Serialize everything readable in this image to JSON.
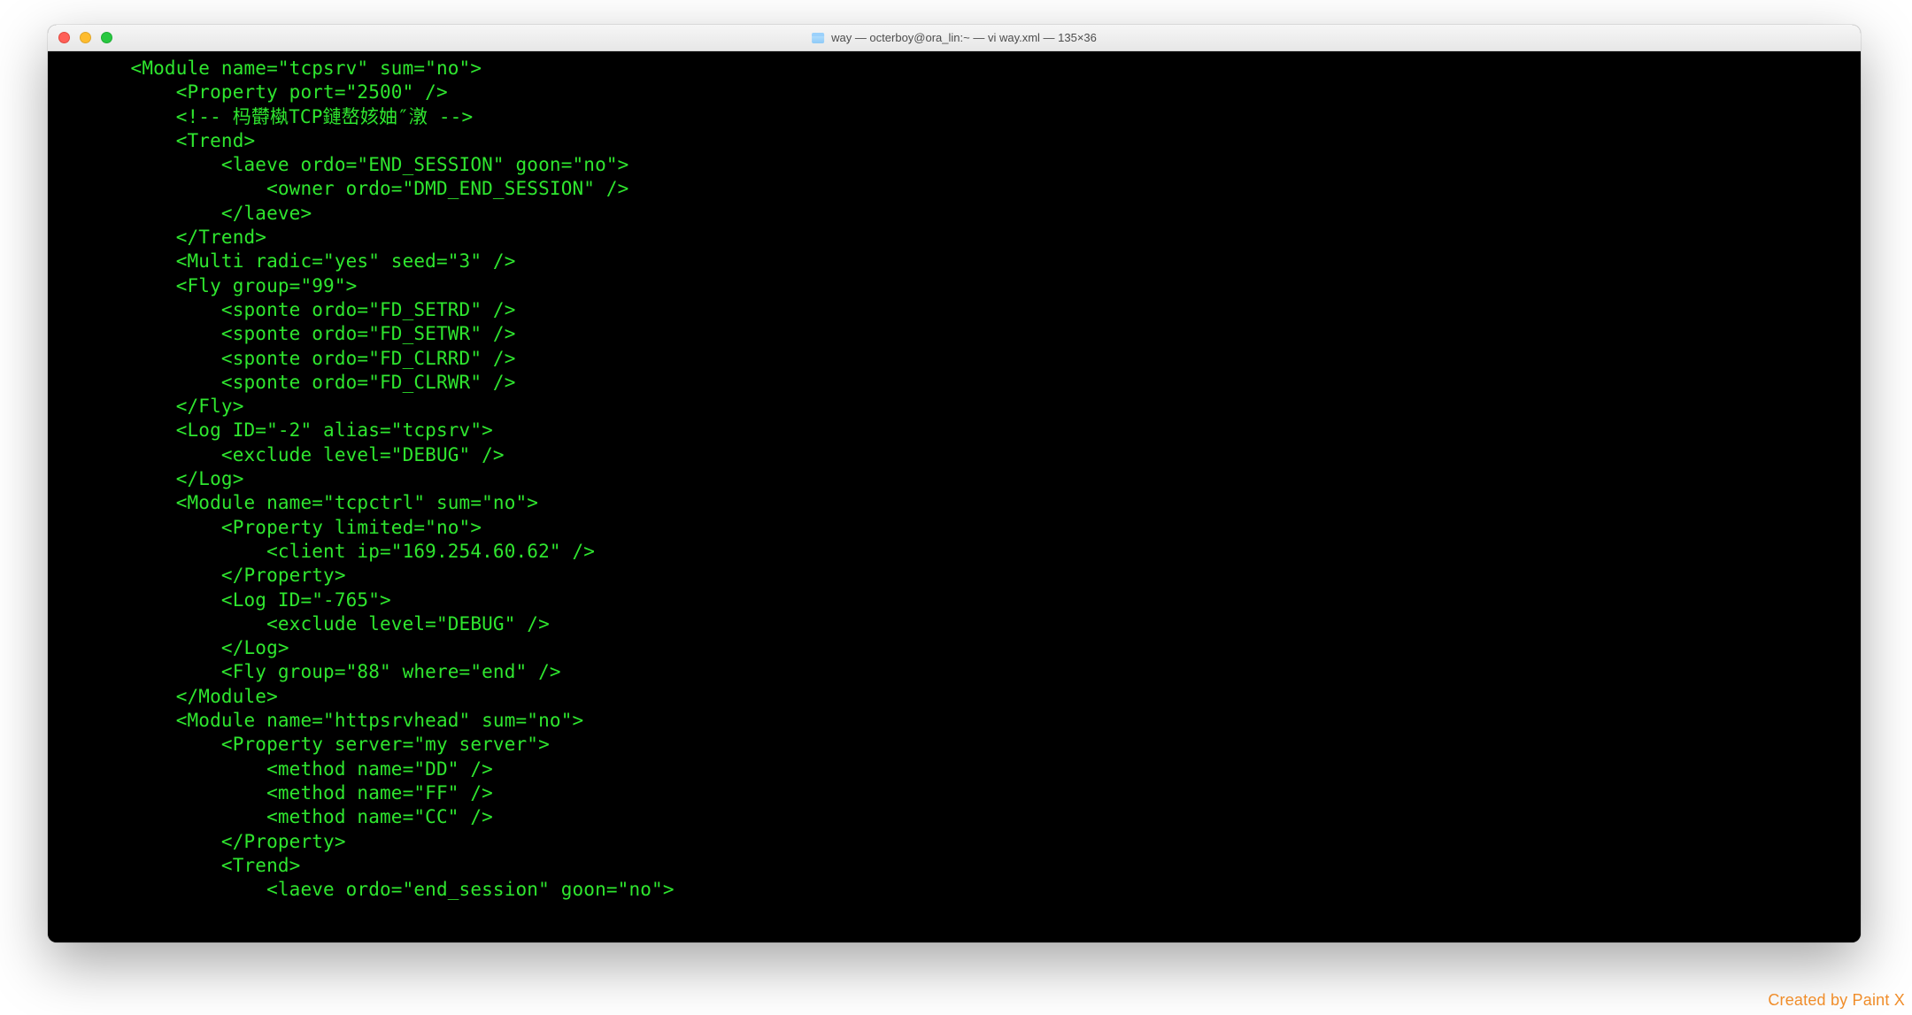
{
  "window": {
    "title": "way — octerboy@ora_lin:~ — vi way.xml — 135×36"
  },
  "terminal": {
    "lines": [
      "       <Module name=\"tcpsrv\" sum=\"no\">",
      "           <Property port=\"2500\" />",
      "           <!-- 杩欎槸TCP鏈嶅姟妯″潡 -->",
      "           <Trend>",
      "               <laeve ordo=\"END_SESSION\" goon=\"no\">",
      "                   <owner ordo=\"DMD_END_SESSION\" />",
      "               </laeve>",
      "           </Trend>",
      "           <Multi radic=\"yes\" seed=\"3\" />",
      "           <Fly group=\"99\">",
      "               <sponte ordo=\"FD_SETRD\" />",
      "               <sponte ordo=\"FD_SETWR\" />",
      "               <sponte ordo=\"FD_CLRRD\" />",
      "               <sponte ordo=\"FD_CLRWR\" />",
      "           </Fly>",
      "           <Log ID=\"-2\" alias=\"tcpsrv\">",
      "               <exclude level=\"DEBUG\" />",
      "           </Log>",
      "           <Module name=\"tcpctrl\" sum=\"no\">",
      "               <Property limited=\"no\">",
      "                   <client ip=\"169.254.60.62\" />",
      "               </Property>",
      "               <Log ID=\"-765\">",
      "                   <exclude level=\"DEBUG\" />",
      "               </Log>",
      "               <Fly group=\"88\" where=\"end\" />",
      "           </Module>",
      "           <Module name=\"httpsrvhead\" sum=\"no\">",
      "               <Property server=\"my server\">",
      "                   <method name=\"DD\" />",
      "                   <method name=\"FF\" />",
      "                   <method name=\"CC\" />",
      "               </Property>",
      "               <Trend>",
      "                   <laeve ordo=\"end_session\" goon=\"no\">"
    ]
  },
  "watermark": "Created by Paint X"
}
